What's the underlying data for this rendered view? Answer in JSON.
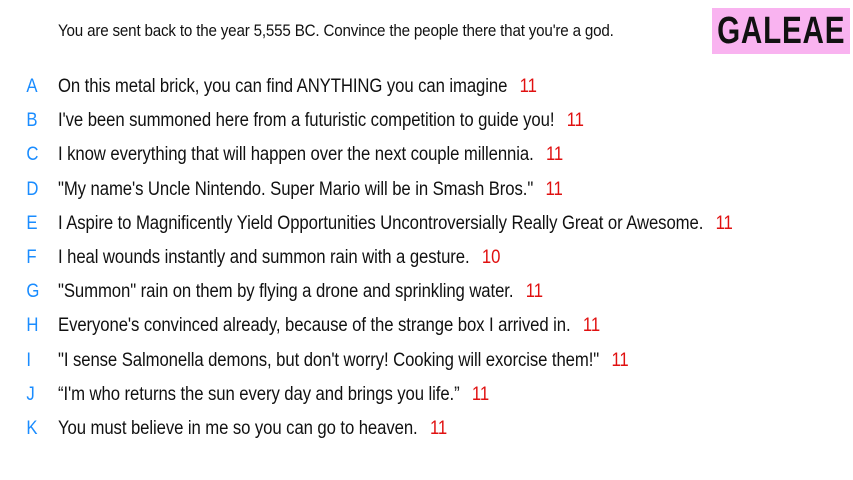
{
  "question": "You are sent back to the year 5,555 BC. Convince the people there that you're a god.",
  "brand": "GALEAE",
  "colors": {
    "letter": "#1a8cff",
    "score": "#e01010",
    "badge_bg": "#f9b3f0",
    "text": "#111111"
  },
  "answers": [
    {
      "letter": "A",
      "text": "On this metal brick, you can find ANYTHING you can imagine",
      "score": "11"
    },
    {
      "letter": "B",
      "text": "I've been summoned here from a futuristic competition to guide you!",
      "score": "11"
    },
    {
      "letter": "C",
      "text": "I know everything that will happen over the next couple millennia.",
      "score": "11"
    },
    {
      "letter": "D",
      "text": "\"My name's Uncle Nintendo. Super Mario will be in Smash Bros.\"",
      "score": "11"
    },
    {
      "letter": "E",
      "text": "I Aspire to Magnificently Yield Opportunities Uncontroversially Really Great or Awesome.",
      "score": "11"
    },
    {
      "letter": "F",
      "text": "I heal wounds instantly and summon rain with a gesture.",
      "score": "10"
    },
    {
      "letter": "G",
      "text": "\"Summon\" rain on them by flying a drone and sprinkling water.",
      "score": "11"
    },
    {
      "letter": "H",
      "text": "Everyone's convinced already, because of the strange box I arrived in.",
      "score": "11"
    },
    {
      "letter": "I",
      "text": "\"I sense Salmonella demons, but don't worry! Cooking will exorcise them!\"",
      "score": "11"
    },
    {
      "letter": "J",
      "text": "“I'm who returns the sun every day and brings you life.”",
      "score": "11"
    },
    {
      "letter": "K",
      "text": "You must believe in me so you can go to heaven.",
      "score": "11"
    }
  ]
}
